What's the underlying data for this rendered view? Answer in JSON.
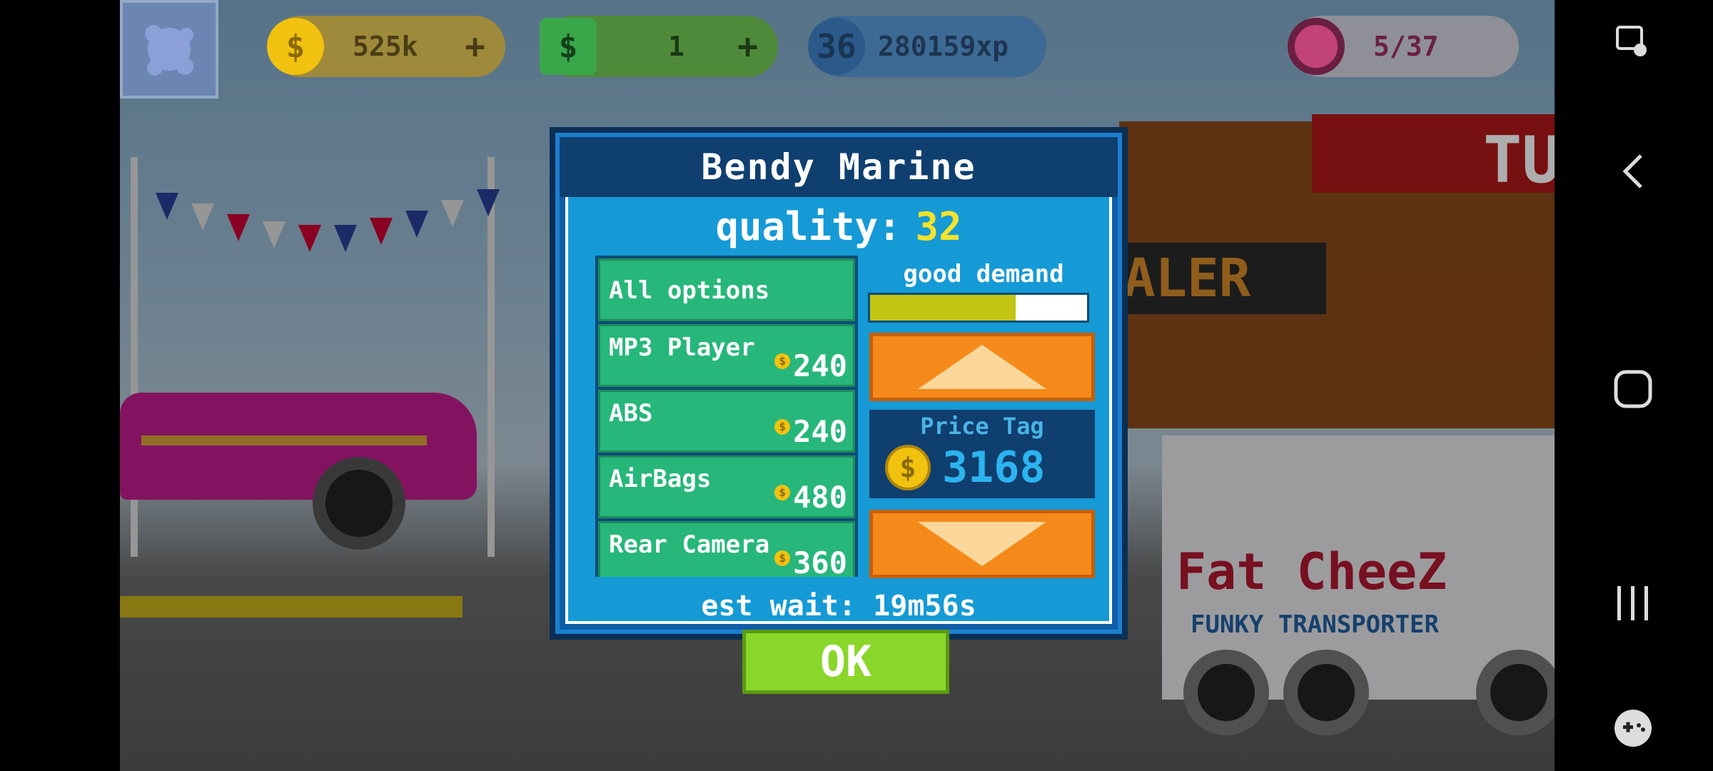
{
  "hud": {
    "coins": "525k",
    "cash": "1",
    "level": "36",
    "xp": "280159xp",
    "donuts": "5/37",
    "plus": "+"
  },
  "dialog": {
    "title": "Bendy Marine",
    "quality_label": "quality:",
    "quality_value": "32",
    "demand_label": "good demand",
    "demand_level": 0.67,
    "options": [
      {
        "name": "All options",
        "price": ""
      },
      {
        "name": "MP3 Player",
        "price": "240"
      },
      {
        "name": "ABS",
        "price": "240"
      },
      {
        "name": "AirBags",
        "price": "480"
      },
      {
        "name": "Rear Camera",
        "price": "360"
      }
    ],
    "price_label": "Price Tag",
    "price_value": "3168",
    "wait_label": "est wait:",
    "wait_value": "19m56s",
    "ok_label": "OK"
  },
  "scene": {
    "shop_sign": "ALER",
    "shop_roof": "TU",
    "truck_name": "Fat CheeZ",
    "truck_sub": "FUNKY TRANSPORTER"
  },
  "colors": {
    "dialog_bg": "#159ad6",
    "option_green": "#27b77a",
    "arrow_orange": "#f58a1a",
    "ok_green": "#8ad62a",
    "quality_yellow": "#f5e22a"
  }
}
